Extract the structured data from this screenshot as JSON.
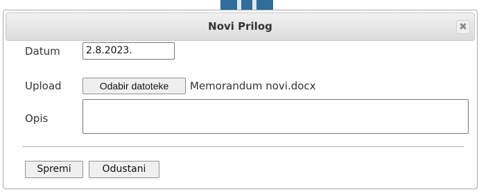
{
  "dialog": {
    "title": "Novi Prilog",
    "close_icon": "close-icon",
    "close_glyph": "✖"
  },
  "form": {
    "date_label": "Datum",
    "date_value": "2.8.2023.",
    "upload_label": "Upload",
    "file_button_label": "Odabir datoteke",
    "file_name": "Memorandum novi.docx",
    "description_label": "Opis",
    "description_value": ""
  },
  "buttons": {
    "save_label": "Spremi",
    "cancel_label": "Odustani"
  },
  "colors": {
    "titlebar": "#dcdcdc",
    "backdrop_accent": "#2f6e9a",
    "text": "#333333"
  }
}
